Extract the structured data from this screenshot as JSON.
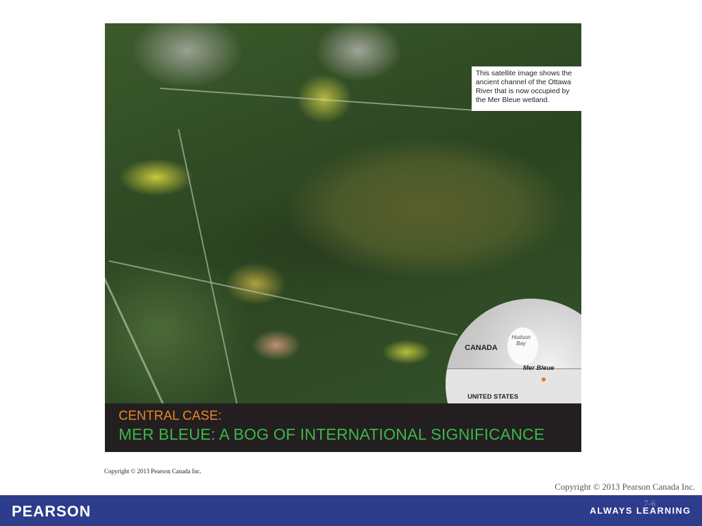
{
  "figure": {
    "caption": "This satellite image shows the ancient channel of the Ottawa River that is now occupied by the Mer Bleue wetland.",
    "map_labels": {
      "canada": "CANADA",
      "hudson_bay": "Hudson Bay",
      "mer_bleue": "Mer Bleue",
      "united_states": "UNITED STATES"
    },
    "banner": {
      "line1": "CENTRAL CASE:",
      "line2": "MER BLEUE: A BOG OF INTERNATIONAL SIGNIFICANCE"
    },
    "copyright": "Copyright © 2013 Pearson Canada Inc."
  },
  "slide": {
    "copyright": "Copyright © 2013 Pearson Canada Inc.",
    "page_number": "7-6"
  },
  "footer": {
    "logo": "PEARSON",
    "slogan": "ALWAYS LEARNING"
  },
  "colors": {
    "footer": "#2e3c8c",
    "banner": "#231f20",
    "banner_line1": "#e8852a",
    "banner_line2": "#3cb84a"
  }
}
